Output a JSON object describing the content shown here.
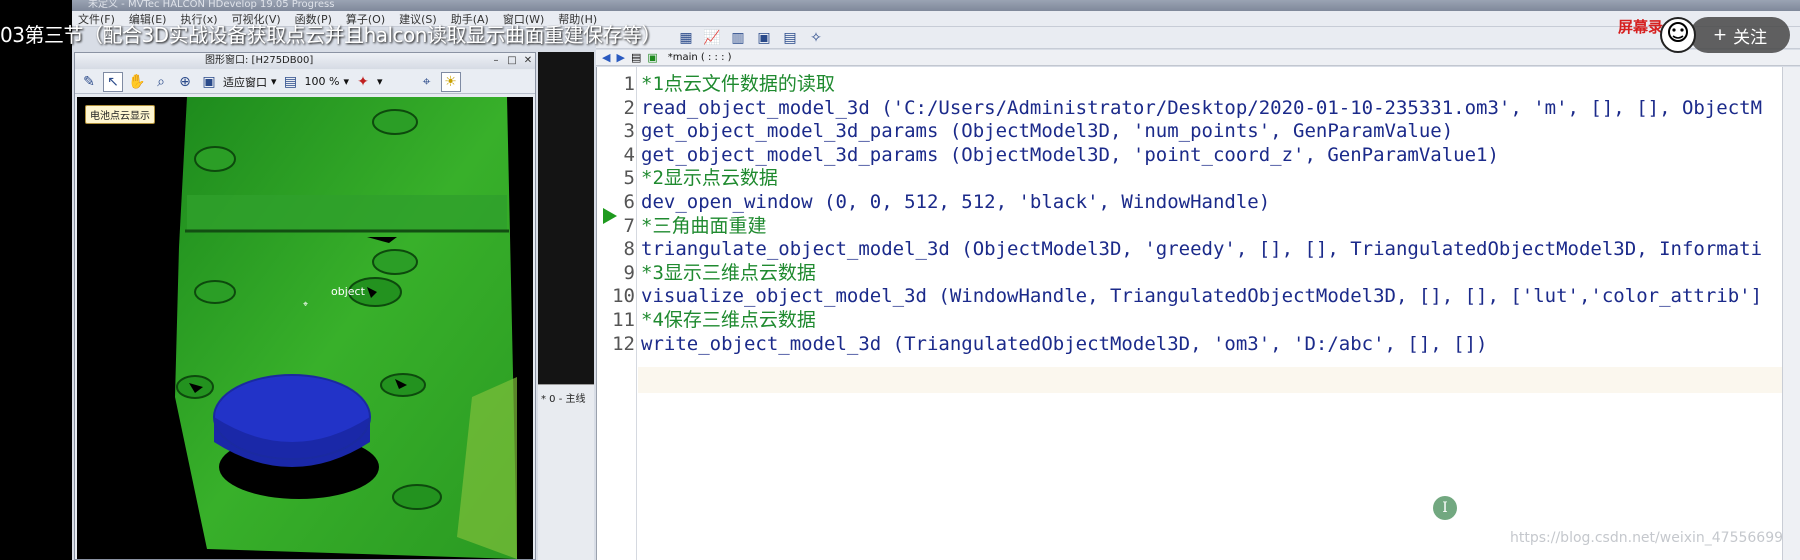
{
  "window": {
    "title": "未定义 - MVTec HALCON HDevelop 19.05 Progress"
  },
  "menubar": {
    "items": [
      "文件(F)",
      "编辑(E)",
      "执行(x)",
      "可视化(V)",
      "函数(P)",
      "算子(O)",
      "建议(S)",
      "助手(A)",
      "窗口(W)",
      "帮助(H)"
    ]
  },
  "overlay": {
    "video_title": "03第三节（配合3D实战设备获取点云并且halcon读取显示曲面重建保存等）",
    "brand": "屏幕录",
    "follow_label": "关注",
    "follow_icon": "plus-icon",
    "watermark": "https://blog.csdn.net/weixin_47556699"
  },
  "graphics_window": {
    "title": "图形窗口: [H275DB00]",
    "fit_label": "适应窗口",
    "zoom": "100 %",
    "image_label": "电池点云显示",
    "object_label": "object"
  },
  "mid_panel": {
    "text": "* 0 - 主线"
  },
  "editor": {
    "tab": "*main ( : : : )",
    "lines": [
      {
        "n": "1",
        "text": "*1点云文件数据的读取",
        "comment": true
      },
      {
        "n": "2",
        "text": "read_object_model_3d ('C:/Users/Administrator/Desktop/2020-01-10-235331.om3', 'm', [], [], ObjectM",
        "comment": false
      },
      {
        "n": "3",
        "text": "get_object_model_3d_params (ObjectModel3D, 'num_points', GenParamValue)",
        "comment": false
      },
      {
        "n": "4",
        "text": "get_object_model_3d_params (ObjectModel3D, 'point_coord_z', GenParamValue1)",
        "comment": false
      },
      {
        "n": "5",
        "text": "*2显示点云数据",
        "comment": true
      },
      {
        "n": "6",
        "text": "dev_open_window (0, 0, 512, 512, 'black', WindowHandle)",
        "comment": false
      },
      {
        "n": "7",
        "text": "*三角曲面重建",
        "comment": true
      },
      {
        "n": "8",
        "text": "triangulate_object_model_3d (ObjectModel3D, 'greedy', [], [], TriangulatedObjectModel3D, Informati",
        "comment": false
      },
      {
        "n": "9",
        "text": "*3显示三维点云数据",
        "comment": true
      },
      {
        "n": "10",
        "text": "visualize_object_model_3d (WindowHandle, TriangulatedObjectModel3D, [], [], ['lut','color_attrib']",
        "comment": false
      },
      {
        "n": "11",
        "text": "*4保存三维点云数据",
        "comment": true
      },
      {
        "n": "12",
        "text": "write_object_model_3d (TriangulatedObjectModel3D, 'om3', 'D:/abc', [], [])",
        "comment": false
      }
    ],
    "cursor_glyph": "I"
  }
}
